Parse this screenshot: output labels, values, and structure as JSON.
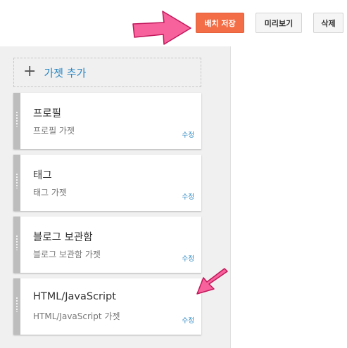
{
  "toolbar": {
    "save_label": "배치 저장",
    "preview_label": "미리보기",
    "delete_label": "삭제"
  },
  "layout_panel": {
    "add_gadget_label": "가젯 추가",
    "gadgets": [
      {
        "title": "프로필",
        "subtitle": "프로필 가젯",
        "edit_label": "수정"
      },
      {
        "title": "태그",
        "subtitle": "태그 가젯",
        "edit_label": "수정"
      },
      {
        "title": "블로그 보관함",
        "subtitle": "블로그 보관함 가젯",
        "edit_label": "수정"
      },
      {
        "title": "HTML/JavaScript",
        "subtitle": "HTML/JavaScript 가젯",
        "edit_label": "수정"
      }
    ]
  },
  "colors": {
    "save_button": "#f36d46",
    "link_blue": "#2a87c2",
    "annotation_arrow": "#f7629c",
    "panel_background": "#f0f0f0",
    "grip": "#bdbdbd"
  },
  "icons": {
    "add": "plus-icon",
    "drag": "drag-handle-icon",
    "annotation": "arrow-icon"
  }
}
